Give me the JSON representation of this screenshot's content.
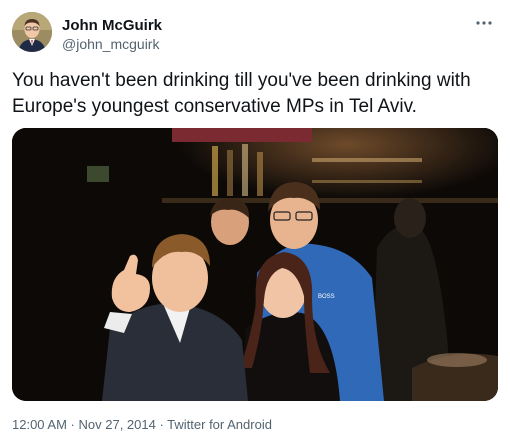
{
  "author": {
    "name": "John McGuirk",
    "handle": "@john_mcguirk",
    "avatar_icon": "profile-photo"
  },
  "more_icon": "ellipsis-icon",
  "tweet": {
    "text": "You haven't been drinking till you've been drinking with Europe's youngest conservative MPs in Tel Aviv."
  },
  "photo": {
    "shirt_text": "BOSS"
  },
  "meta": {
    "time": "12:00 AM",
    "separator": " · ",
    "date": "Nov 27, 2014",
    "source": "Twitter for Android"
  },
  "colors": {
    "text": "#0f1419",
    "secondary": "#536471",
    "background": "#ffffff"
  }
}
